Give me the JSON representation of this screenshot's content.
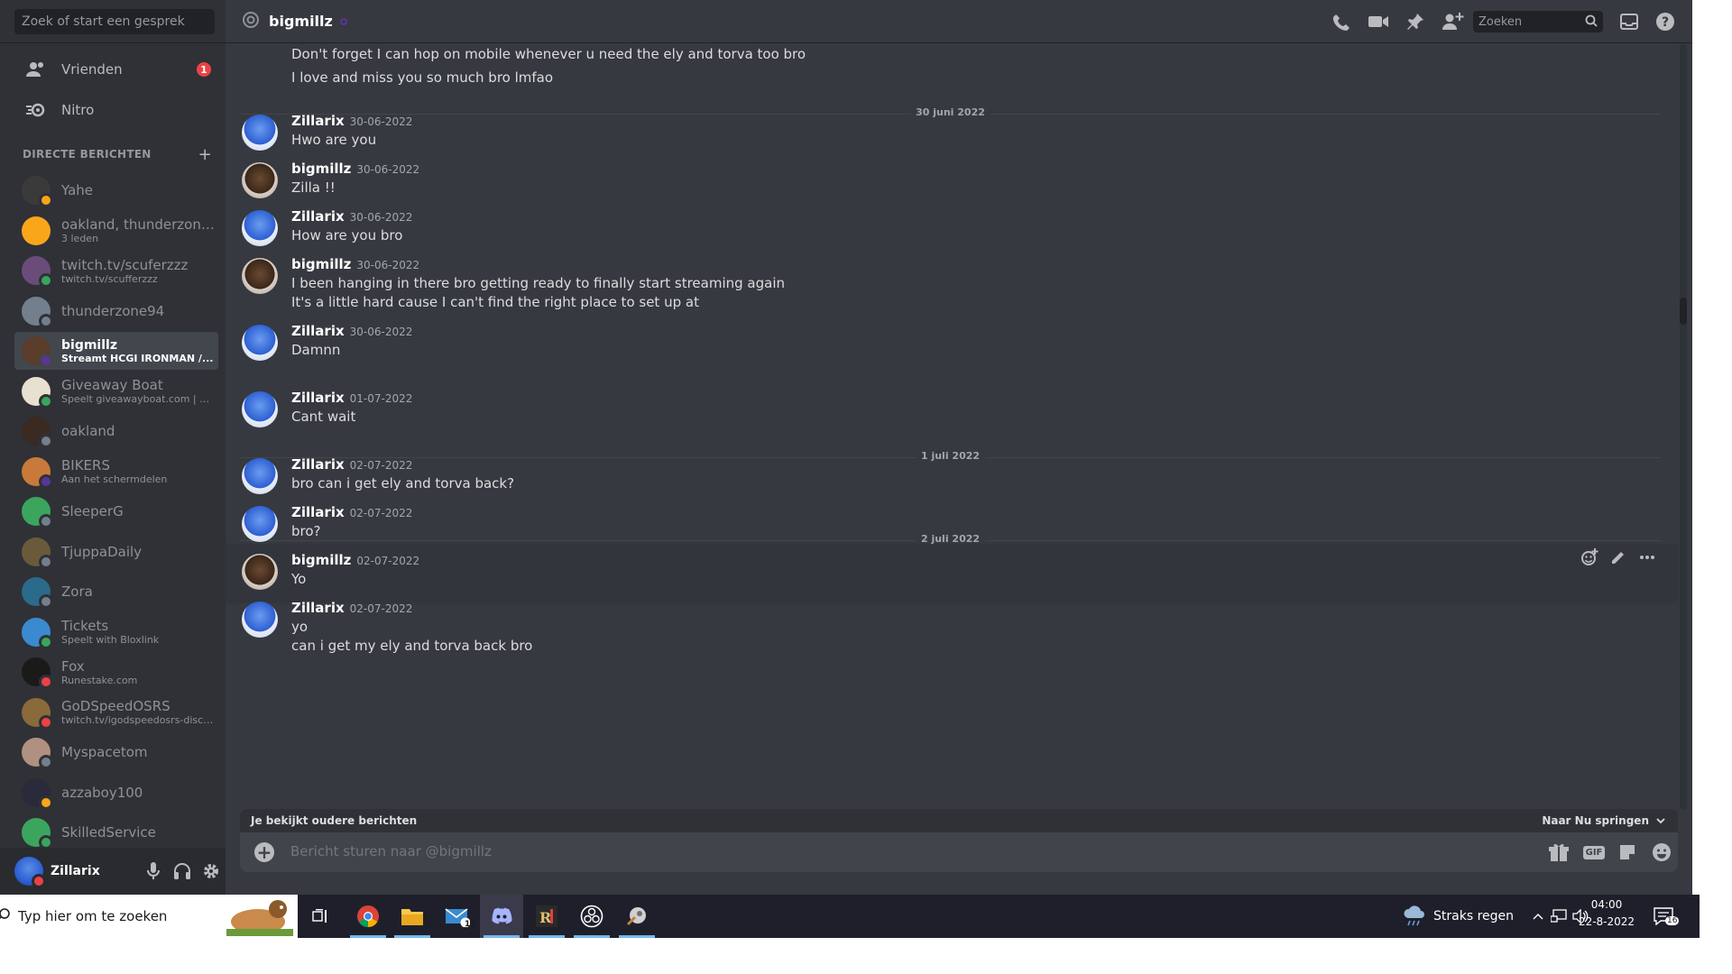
{
  "sidebar": {
    "search_placeholder": "Zoek of start een gesprek",
    "nav": [
      {
        "label": "Vrienden",
        "badge": "1",
        "icon": "friends-icon"
      },
      {
        "label": "Nitro",
        "icon": "nitro-icon"
      }
    ],
    "dm_header": "DIRECTE BERICHTEN",
    "dm_add": "+",
    "dms": [
      {
        "name": "Yahe",
        "sub": "",
        "status": "idle",
        "avatar_color": "#3a3a3a"
      },
      {
        "name": "oakland, thunderzone94",
        "sub": "3 leden",
        "status": "",
        "avatar_color": "#faa61a"
      },
      {
        "name": "twitch.tv/scuferzzz",
        "sub": "twitch.tv/scufferzzz",
        "status": "online",
        "avatar_color": "#6a4c7a"
      },
      {
        "name": "thunderzone94",
        "sub": "",
        "status": "offline",
        "avatar_color": "#747f8d"
      },
      {
        "name": "bigmillz",
        "sub": "Streamt HCGI IRONMAN /...",
        "status": "streaming",
        "avatar_color": "#5a3d2b",
        "active": true
      },
      {
        "name": "Giveaway Boat",
        "sub": "Speelt giveawayboat.com | g.h...",
        "status": "online",
        "avatar_color": "#e8e0d0"
      },
      {
        "name": "oakland",
        "sub": "",
        "status": "offline",
        "avatar_color": "#3b2a22"
      },
      {
        "name": "BIKERS",
        "sub": "Aan het schermdelen",
        "status": "streaming",
        "avatar_color": "#c97a3a"
      },
      {
        "name": "SleeperG",
        "sub": "",
        "status": "offline",
        "avatar_color": "#3ba55d"
      },
      {
        "name": "TjuppaDaily",
        "sub": "",
        "status": "offline",
        "avatar_color": "#6b5a3a"
      },
      {
        "name": "Zora",
        "sub": "",
        "status": "offline",
        "avatar_color": "#2a6a8a"
      },
      {
        "name": "Tickets",
        "sub": "Speelt with Bloxlink",
        "status": "online",
        "avatar_color": "#3a8ad0"
      },
      {
        "name": "Fox",
        "sub": "Runestake.com",
        "status": "dnd",
        "avatar_color": "#1a1a1a"
      },
      {
        "name": "GoDSpeedOSRS",
        "sub": "twitch.tv/igodspeedosrs-disco...",
        "status": "dnd",
        "avatar_color": "#8a6a3a"
      },
      {
        "name": "Myspacetom",
        "sub": "",
        "status": "offline",
        "avatar_color": "#b09080"
      },
      {
        "name": "azzaboy100",
        "sub": "",
        "status": "idle",
        "avatar_color": "#2a2a3a"
      },
      {
        "name": "SkilledService",
        "sub": "",
        "status": "online",
        "avatar_color": "#3ba55d"
      }
    ]
  },
  "user_panel": {
    "name": "Zillarix",
    "status": "dnd"
  },
  "header": {
    "title": "bigmillz",
    "search_placeholder": "Zoeken"
  },
  "messages": {
    "top_lines": [
      "Don't forget I can hop on mobile whenever u need the ely and torva too bro",
      "I love and miss you so much bro lmfao"
    ],
    "dividers": [
      "30 juni 2022",
      "1 juli 2022",
      "2 juli 2022"
    ],
    "items": [
      {
        "author": "Zillarix",
        "time": "30-06-2022",
        "lines": [
          "Hwo are you"
        ],
        "avatar": "zillarix"
      },
      {
        "author": "bigmillz",
        "time": "30-06-2022",
        "lines": [
          "Zilla !!"
        ],
        "avatar": "bigmillz"
      },
      {
        "author": "Zillarix",
        "time": "30-06-2022",
        "lines": [
          "How are you bro"
        ],
        "avatar": "zillarix"
      },
      {
        "author": "bigmillz",
        "time": "30-06-2022",
        "lines": [
          "I been hanging in there bro getting ready to finally start streaming again",
          "It's a little hard cause I can't find the right place to set up at"
        ],
        "avatar": "bigmillz"
      },
      {
        "author": "Zillarix",
        "time": "30-06-2022",
        "lines": [
          "Damnn"
        ],
        "avatar": "zillarix"
      },
      {
        "author": "Zillarix",
        "time": "01-07-2022",
        "lines": [
          "Cant wait"
        ],
        "avatar": "zillarix"
      },
      {
        "author": "Zillarix",
        "time": "02-07-2022",
        "lines": [
          "bro can i get ely and torva back?"
        ],
        "avatar": "zillarix"
      },
      {
        "author": "Zillarix",
        "time": "02-07-2022",
        "lines": [
          "bro?"
        ],
        "avatar": "zillarix"
      },
      {
        "author": "bigmillz",
        "time": "02-07-2022",
        "lines": [
          "Yo"
        ],
        "avatar": "bigmillz"
      },
      {
        "author": "Zillarix",
        "time": "02-07-2022",
        "lines": [
          "yo",
          "can i get my ely and torva back bro"
        ],
        "avatar": "zillarix"
      }
    ]
  },
  "jump_bar": {
    "left": "Je bekijkt oudere berichten",
    "right": "Naar Nu springen"
  },
  "composer": {
    "placeholder": "Bericht sturen naar @bigmillz",
    "gif": "GIF"
  },
  "taskbar": {
    "search_placeholder": "Typ hier om te zoeken",
    "weather": "Straks regen",
    "time": "04:00",
    "date": "22-8-2022",
    "mail_badge": "11",
    "notif_badge": "16"
  },
  "colors": {
    "online": "#3ba55d",
    "idle": "#faa61a",
    "dnd": "#ed4245",
    "offline": "#747f8d",
    "streaming": "#593695"
  }
}
